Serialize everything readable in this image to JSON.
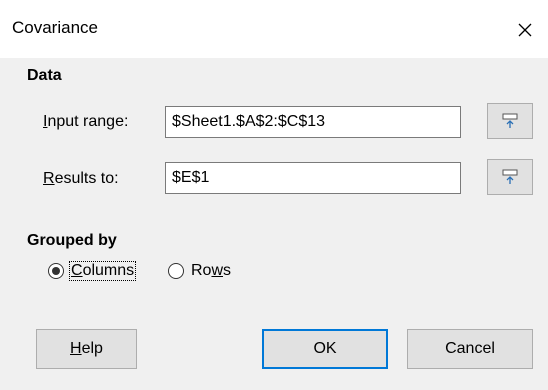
{
  "window": {
    "title": "Covariance"
  },
  "data_section": {
    "heading": "Data",
    "input_range": {
      "label_mnemonic": "I",
      "label_rest": "nput range:",
      "value": "$Sheet1.$A$2:$C$13"
    },
    "results_to": {
      "label_mnemonic": "R",
      "label_rest": "esults to:",
      "value": "$E$1"
    }
  },
  "grouped_by": {
    "heading": "Grouped by",
    "columns": {
      "mnemonic": "C",
      "rest": "olumns",
      "selected": true
    },
    "rows": {
      "prefix": "Ro",
      "mnemonic": "w",
      "rest": "s",
      "selected": false
    }
  },
  "buttons": {
    "help": {
      "mnemonic": "H",
      "rest": "elp"
    },
    "ok": "OK",
    "cancel": "Cancel"
  },
  "icons": {
    "close": "close-icon",
    "shrink": "shrink-icon"
  },
  "colors": {
    "accent": "#0078d7",
    "dialog_bg": "#f0f0f0"
  }
}
